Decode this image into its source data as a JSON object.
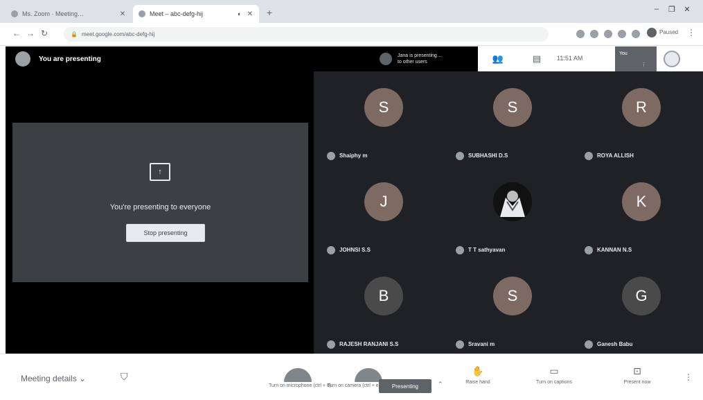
{
  "browser": {
    "tabs": [
      {
        "title": "Ms. Zoom · Meeting…"
      },
      {
        "title": "Meet – abc-defg-hij"
      }
    ],
    "newtab_icon": "+",
    "window_controls": [
      "–",
      "❐",
      "✕"
    ],
    "url": "meet.google.com/abc-defg-hij",
    "profile_label": "Paused"
  },
  "meet": {
    "presenter_banner": "You are presenting",
    "pinned": {
      "line1": "Jana is presenting…",
      "line2": "to other users"
    },
    "time": "11:51 AM",
    "thumb_label": "You",
    "present_card": {
      "message": "You're presenting to everyone",
      "stop_label": "Stop presenting",
      "icon_glyph": "↑"
    },
    "participants": [
      {
        "initial": "S",
        "name": "Shaiphy m",
        "color": "#8d6e63"
      },
      {
        "initial": "S",
        "name": "SUBHASHI D.S",
        "color": "#8d6e63"
      },
      {
        "initial": "R",
        "name": "ROYA ALLISH",
        "color": "#8d6e63"
      },
      {
        "initial": "J",
        "name": "JOHNSI S.S",
        "color": "#8d6e63"
      },
      {
        "initial": "",
        "name": "T T sathyavan",
        "color": "#000000",
        "photo": true
      },
      {
        "initial": "K",
        "name": "KANNAN N.S",
        "color": "#8d6e63"
      },
      {
        "initial": "B",
        "name": "RAJESH RANJANI S.S",
        "color": "#4e4e4e"
      },
      {
        "initial": "S",
        "name": "Sravani m",
        "color": "#8d6e63"
      },
      {
        "initial": "G",
        "name": "Ganesh Babu",
        "color": "#4e4e4e"
      }
    ]
  },
  "bottombar": {
    "meeting_details": "Meeting details ⌄",
    "mic_label": "Turn on microphone (ctrl + d)",
    "cam_label": "Turn on camera (ctrl + e)",
    "present_label": "Presenting",
    "raise_hand": "Raise hand",
    "captions": "Turn on captions",
    "present_now": "Present now",
    "chevron": "⌃"
  },
  "colors": {
    "accent": "#1a73e8",
    "stage_bg": "#202124"
  }
}
